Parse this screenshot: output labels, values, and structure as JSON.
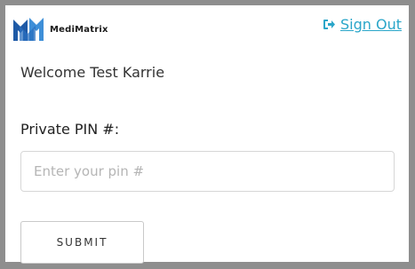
{
  "header": {
    "logo": {
      "text": "MediMatrix",
      "icon": "medimatrix-logo",
      "colors": [
        "#1f5aa6",
        "#3e8fd8"
      ]
    },
    "sign_out": {
      "label": "Sign Out",
      "icon": "sign-out-icon",
      "color": "#2aa6c9"
    }
  },
  "main": {
    "welcome_text": "Welcome Test Karrie",
    "pin_label": "Private PIN #:",
    "pin_field": {
      "value": "",
      "placeholder": "Enter your pin #"
    },
    "submit_label": "SUBMIT"
  }
}
